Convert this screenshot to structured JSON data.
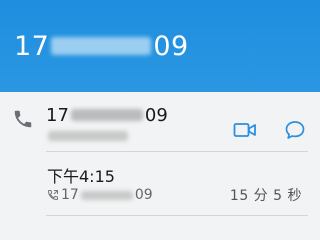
{
  "header": {
    "number_prefix": "17",
    "number_suffix": "09"
  },
  "contact": {
    "number_prefix": "17",
    "number_suffix": "09",
    "phone_icon": "phone-icon",
    "video_icon": "video-call-icon",
    "message_icon": "message-icon"
  },
  "call_log": {
    "time": "下午4:15",
    "number_prefix": "17",
    "number_suffix": "09",
    "call_icon": "outgoing-call-icon",
    "duration": "15 分 5 秒"
  },
  "colors": {
    "header_bg": "#2194e0",
    "accent": "#2c8fe0",
    "card_bg": "#f1f3f4"
  }
}
